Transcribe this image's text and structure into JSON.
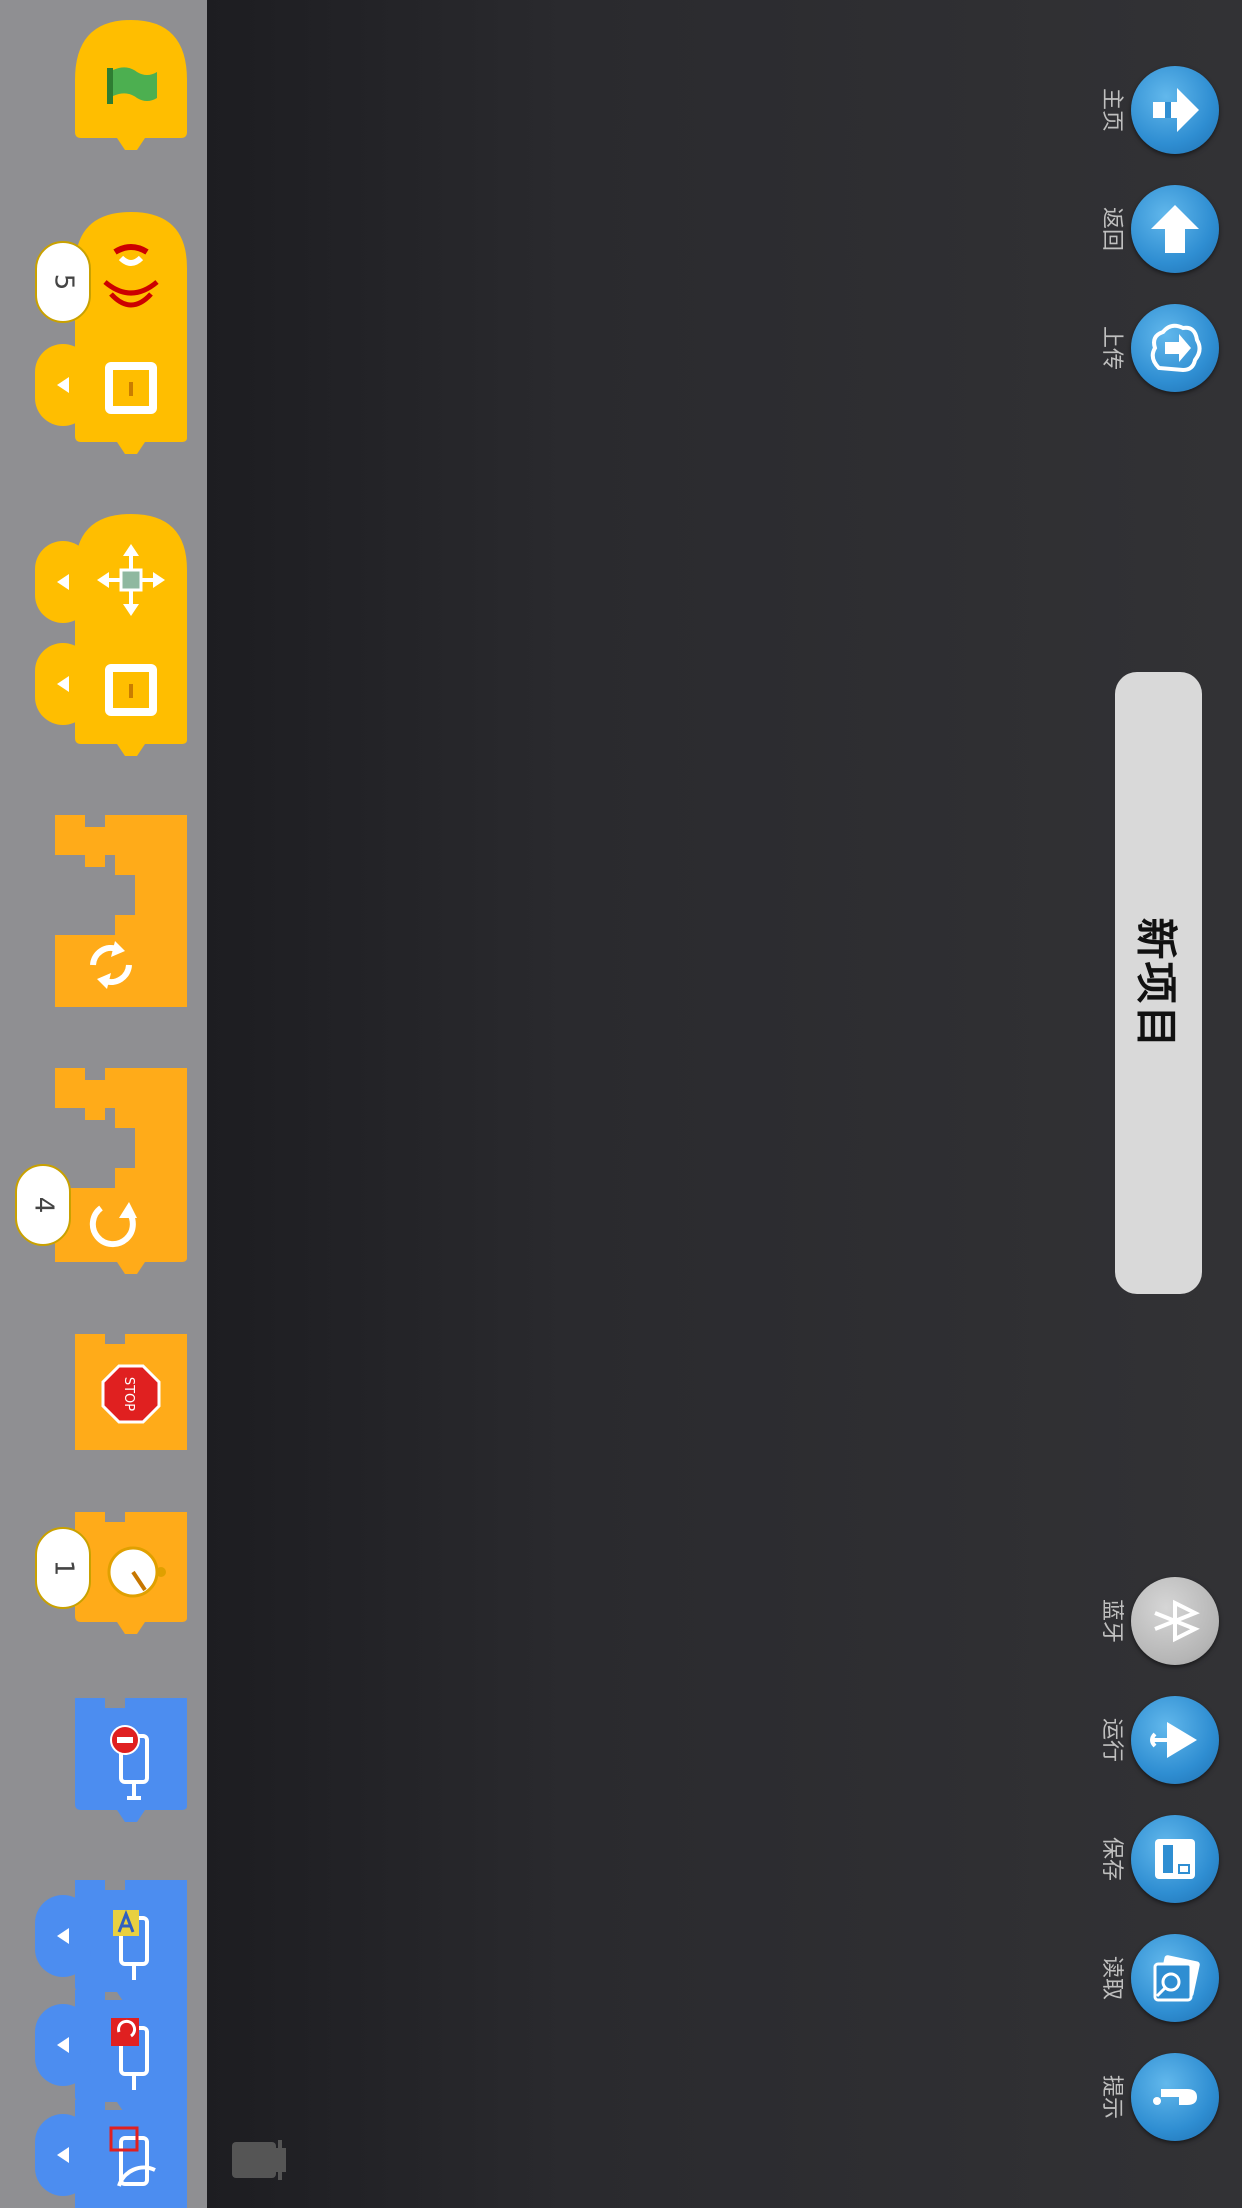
{
  "side_buttons_top": [
    {
      "label": "主页",
      "icon": "home-arrow-icon"
    },
    {
      "label": "返回",
      "icon": "up-arrow-icon"
    },
    {
      "label": "上传",
      "icon": "cloud-upload-icon"
    }
  ],
  "side_buttons_bottom": [
    {
      "label": "蓝牙",
      "icon": "bluetooth-icon"
    },
    {
      "label": "运行",
      "icon": "run-icon"
    },
    {
      "label": "保存",
      "icon": "save-icon"
    },
    {
      "label": "读取",
      "icon": "load-icon"
    },
    {
      "label": "提示",
      "icon": "help-icon"
    }
  ],
  "project": {
    "title": "新项目"
  },
  "palette": {
    "sensor_block_value": "5",
    "repeat_block_value": "4",
    "wait_block_value": "1",
    "stop_sign_text": "STOP"
  },
  "colors": {
    "event_yellow": "#ffbe00",
    "control_orange": "#ffab19",
    "action_blue": "#4c8df0",
    "palette_bg": "#8f8f92",
    "stage_bg": "#2a2a2e"
  }
}
